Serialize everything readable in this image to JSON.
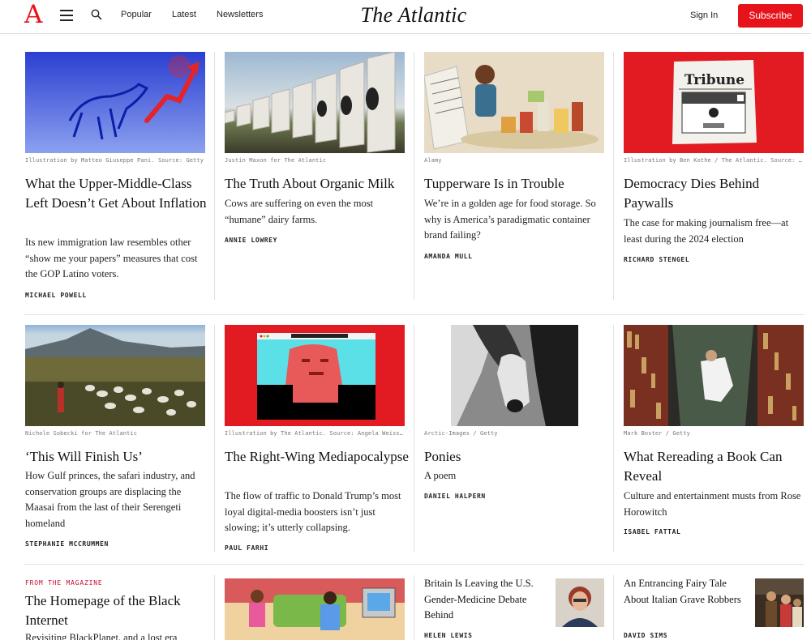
{
  "header": {
    "logo_letter": "A",
    "masthead": "The Atlantic",
    "nav": [
      "Popular",
      "Latest",
      "Newsletters"
    ],
    "sign_in": "Sign In",
    "subscribe": "Subscribe",
    "accent_color": "#e7131a"
  },
  "row1": [
    {
      "credit": "Illustration by Matteo Giuseppe Pani. Source: Getty",
      "headline": "What the Upper-Middle-Class Left Doesn’t Get About Inflation",
      "dek": "Its new immigration law resembles other “show me your papers” measures that cost the GOP Latino voters.",
      "author": "MICHAEL POWELL"
    },
    {
      "credit": "Justin Maxon for The Atlantic",
      "headline": "The Truth About Organic Milk",
      "dek": "Cows are suffering on even the most “humane” dairy farms.",
      "author": "ANNIE LOWREY"
    },
    {
      "credit": "Alamy",
      "headline": "Tupperware Is in Trouble",
      "dek": "We’re in a golden age for food storage. So why is America’s paradigmatic container brand failing?",
      "author": "AMANDA MULL"
    },
    {
      "credit": "Illustration by Ben Kothe / The Atlantic. Source: Getty",
      "headline": "Democracy Dies Behind Paywalls",
      "dek": "The case for making journalism free—at least during the 2024 election",
      "author": "RICHARD STENGEL"
    }
  ],
  "row2": [
    {
      "credit": "Nichole Sobecki for The Atlantic",
      "headline": "‘This Will Finish Us’",
      "dek": "How Gulf princes, the safari industry, and conservation groups are displacing the Maasai from the last of their Serengeti homeland",
      "author": "STEPHANIE MCCRUMMEN"
    },
    {
      "credit": "Illustration by The Atlantic. Source: Angela Weiss / Getty",
      "headline": "The Right-Wing Mediapocalypse",
      "dek": "The flow of traffic to Donald Trump’s most loyal digital-media boosters isn’t just slowing; it’s utterly collapsing.",
      "author": "PAUL FARHI"
    },
    {
      "credit": "Arctic-Images / Getty",
      "headline": "Ponies",
      "dek": "A poem",
      "author": "DANIEL HALPERN"
    },
    {
      "credit": "Mark Boster / Getty",
      "headline": "What Rereading a Book Can Reveal",
      "dek": "Culture and entertainment musts from Rose Horowitch",
      "author": "ISABEL FATTAL"
    }
  ],
  "row3": {
    "kicker": "FROM THE MAGAZINE",
    "headline": "The Homepage of the Black Internet",
    "dek": "Revisiting BlackPlanet, and a lost era",
    "small": [
      {
        "headline": "Britain Is Leaving the U.S. Gender-Medicine Debate Behind",
        "author": "HELEN LEWIS"
      },
      {
        "headline": "An Entrancing Fairy Tale About Italian Grave Robbers",
        "author": "DAVID SIMS"
      }
    ]
  },
  "illustrations": {
    "tribune": "Tribune"
  }
}
